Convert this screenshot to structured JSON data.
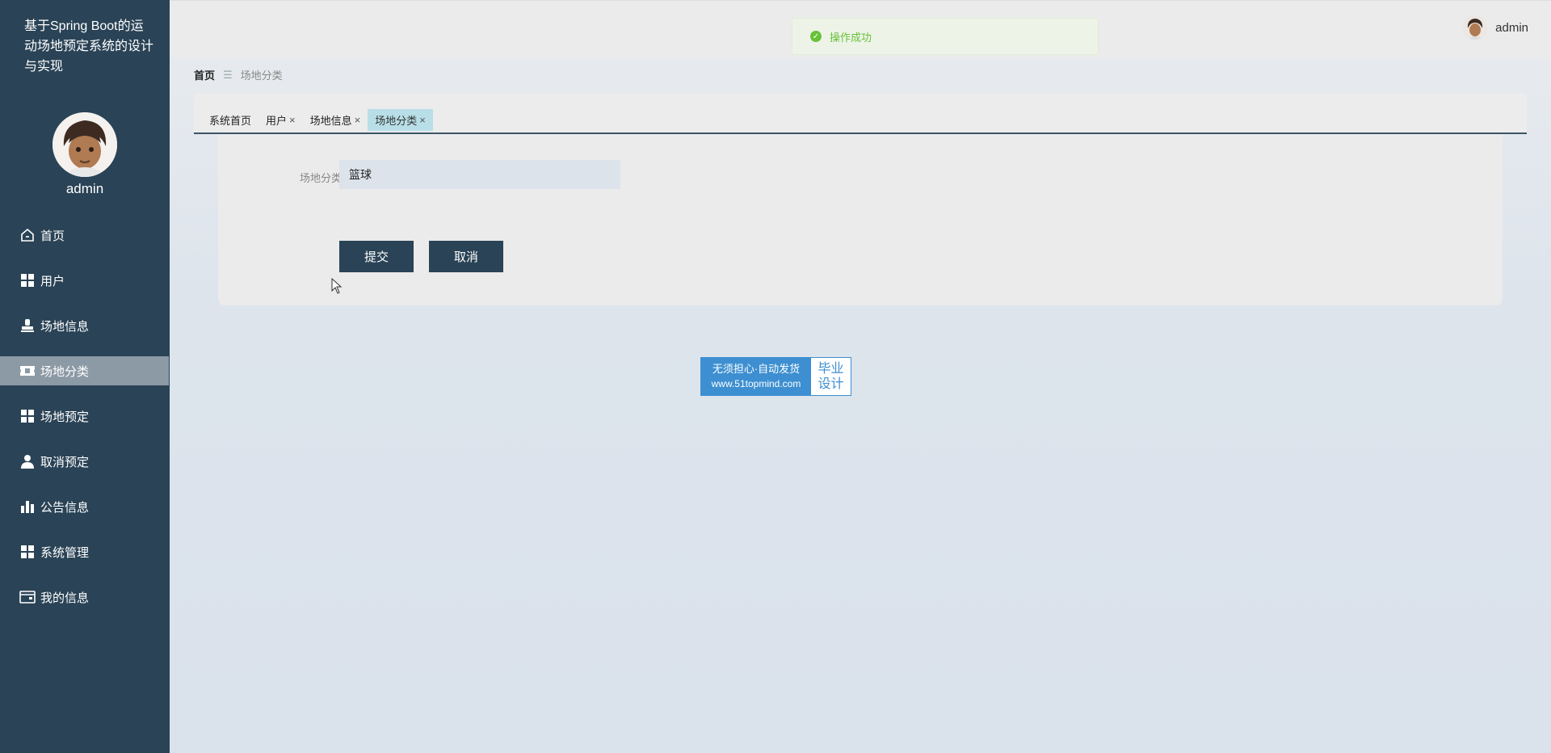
{
  "sidebar": {
    "system_title": "基于Spring Boot的运动场地预定系统的设计与实现",
    "username": "admin",
    "items": [
      {
        "label": "首页",
        "icon": "home-icon",
        "active": false
      },
      {
        "label": "用户",
        "icon": "grid-icon",
        "active": false
      },
      {
        "label": "场地信息",
        "icon": "stamp-icon",
        "active": false
      },
      {
        "label": "场地分类",
        "icon": "ticket-icon",
        "active": true
      },
      {
        "label": "场地预定",
        "icon": "grid-icon",
        "active": false
      },
      {
        "label": "取消预定",
        "icon": "user-icon",
        "active": false
      },
      {
        "label": "公告信息",
        "icon": "bar-chart-icon",
        "active": false
      },
      {
        "label": "系统管理",
        "icon": "grid-icon",
        "active": false
      },
      {
        "label": "我的信息",
        "icon": "card-icon",
        "active": false
      }
    ]
  },
  "topbar": {
    "toast_message": "操作成功",
    "username": "admin"
  },
  "breadcrumb": {
    "home": "首页",
    "separator": "☰",
    "current": "场地分类"
  },
  "tabs": [
    {
      "label": "系统首页",
      "closable": false,
      "active": false
    },
    {
      "label": "用户",
      "closable": true,
      "active": false
    },
    {
      "label": "场地信息",
      "closable": true,
      "active": false
    },
    {
      "label": "场地分类",
      "closable": true,
      "active": true
    }
  ],
  "form": {
    "field_label": "场地分类",
    "field_value": "篮球",
    "submit_label": "提交",
    "cancel_label": "取消"
  },
  "watermark": {
    "line1": "无须担心·自动发货",
    "line2": "www.51topmind.com",
    "right1": "毕业",
    "right2": "设计"
  },
  "colors": {
    "sidebar_bg": "#2a4356",
    "active_item_bg": "#8c9aa5",
    "button_bg": "#2a4356",
    "success": "#67c23a",
    "active_tab": "#b8dfe8"
  }
}
